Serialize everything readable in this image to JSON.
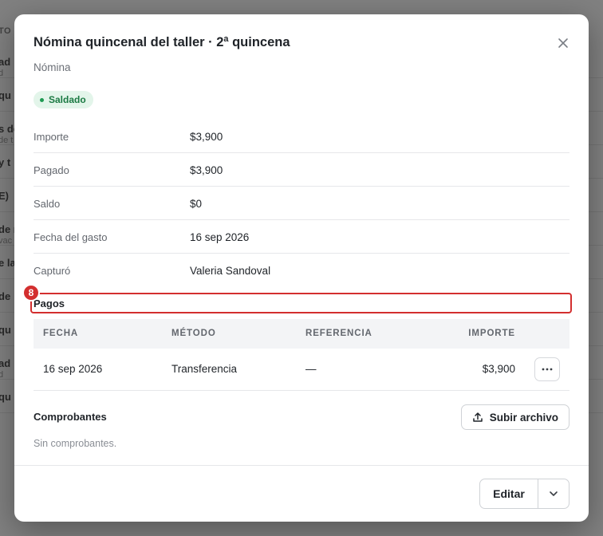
{
  "background": {
    "header_fragment": "TO",
    "rows": [
      {
        "strong": "ad",
        "sub": "d"
      },
      {
        "strong": "qu",
        "sub": ""
      },
      {
        "strong": "s de",
        "sub": "de t"
      },
      {
        "strong": "y t",
        "sub": ""
      },
      {
        "strong": "E)",
        "sub": ""
      },
      {
        "strong": "de n",
        "sub": "vac"
      },
      {
        "strong": "e la",
        "sub": ""
      },
      {
        "strong": "de",
        "sub": ""
      },
      {
        "strong": "qu",
        "sub": ""
      },
      {
        "strong": "ad",
        "sub": "d"
      },
      {
        "strong": "qu",
        "sub": ""
      }
    ]
  },
  "modal": {
    "title": "Nómina quincenal del taller · 2ª quincena",
    "subtitle": "Nómina",
    "close_icon": "close-icon",
    "status_badge": "Saldado",
    "details": [
      {
        "label": "Importe",
        "value": "$3,900"
      },
      {
        "label": "Pagado",
        "value": "$3,900"
      },
      {
        "label": "Saldo",
        "value": "$0"
      },
      {
        "label": "Fecha del gasto",
        "value": "16 sep 2026"
      },
      {
        "label": "Capturó",
        "value": "Valeria Sandoval"
      }
    ],
    "payments": {
      "marker": "8",
      "title": "Pagos",
      "columns": [
        "FECHA",
        "MÉTODO",
        "REFERENCIA",
        "IMPORTE"
      ],
      "rows": [
        {
          "fecha": "16 sep 2026",
          "metodo": "Transferencia",
          "referencia": "—",
          "importe": "$3,900"
        }
      ]
    },
    "receipts": {
      "title": "Comprobantes",
      "upload_label": "Subir archivo",
      "empty_text": "Sin comprobantes."
    },
    "footer": {
      "edit_label": "Editar"
    }
  }
}
